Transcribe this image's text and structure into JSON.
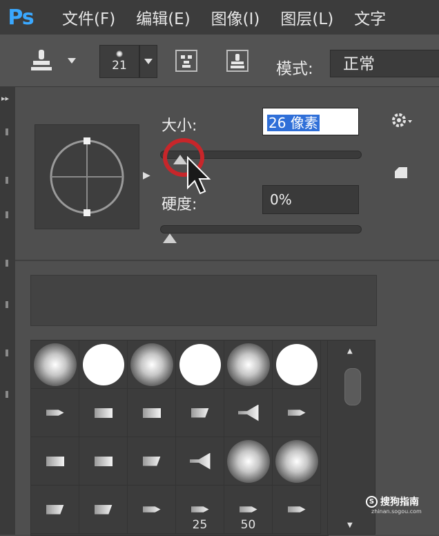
{
  "app": {
    "logo": "Ps"
  },
  "menu": [
    "文件(F)",
    "编辑(E)",
    "图像(I)",
    "图层(L)",
    "文字"
  ],
  "toolbar": {
    "brush_size_display": "21",
    "mode_label": "模式:",
    "mode_value": "正常"
  },
  "left_strip": {
    "collapse_glyph": "▸▸"
  },
  "brush_panel": {
    "size_label": "大小:",
    "size_value": "26 像素",
    "size_slider_fraction": 0.1,
    "hardness_label": "硬度:",
    "hardness_value": "0%",
    "hardness_slider_fraction": 0.0
  },
  "presets": {
    "rows": [
      [
        {
          "type": "soft"
        },
        {
          "type": "hard"
        },
        {
          "type": "soft"
        },
        {
          "type": "hard"
        },
        {
          "type": "soft"
        },
        {
          "type": "hard"
        }
      ],
      [
        {
          "type": "tip-pt"
        },
        {
          "type": "tip"
        },
        {
          "type": "tip"
        },
        {
          "type": "tip-ang"
        },
        {
          "type": "tip-fan"
        },
        {
          "type": "tip-pt"
        }
      ],
      [
        {
          "type": "tip"
        },
        {
          "type": "tip"
        },
        {
          "type": "tip-ang"
        },
        {
          "type": "tip-fan"
        },
        {
          "type": "soft"
        },
        {
          "type": "soft"
        }
      ],
      [
        {
          "type": "tip-ang"
        },
        {
          "type": "tip-ang"
        },
        {
          "type": "tip-pt"
        },
        {
          "type": "tip-pt",
          "label": "25"
        },
        {
          "type": "tip-pt",
          "label": "50"
        },
        {
          "type": "tip-pt"
        }
      ]
    ]
  },
  "watermark": {
    "logo_glyph": "S",
    "main": "搜狗指南",
    "sub": "zhinan.sogou.com"
  }
}
